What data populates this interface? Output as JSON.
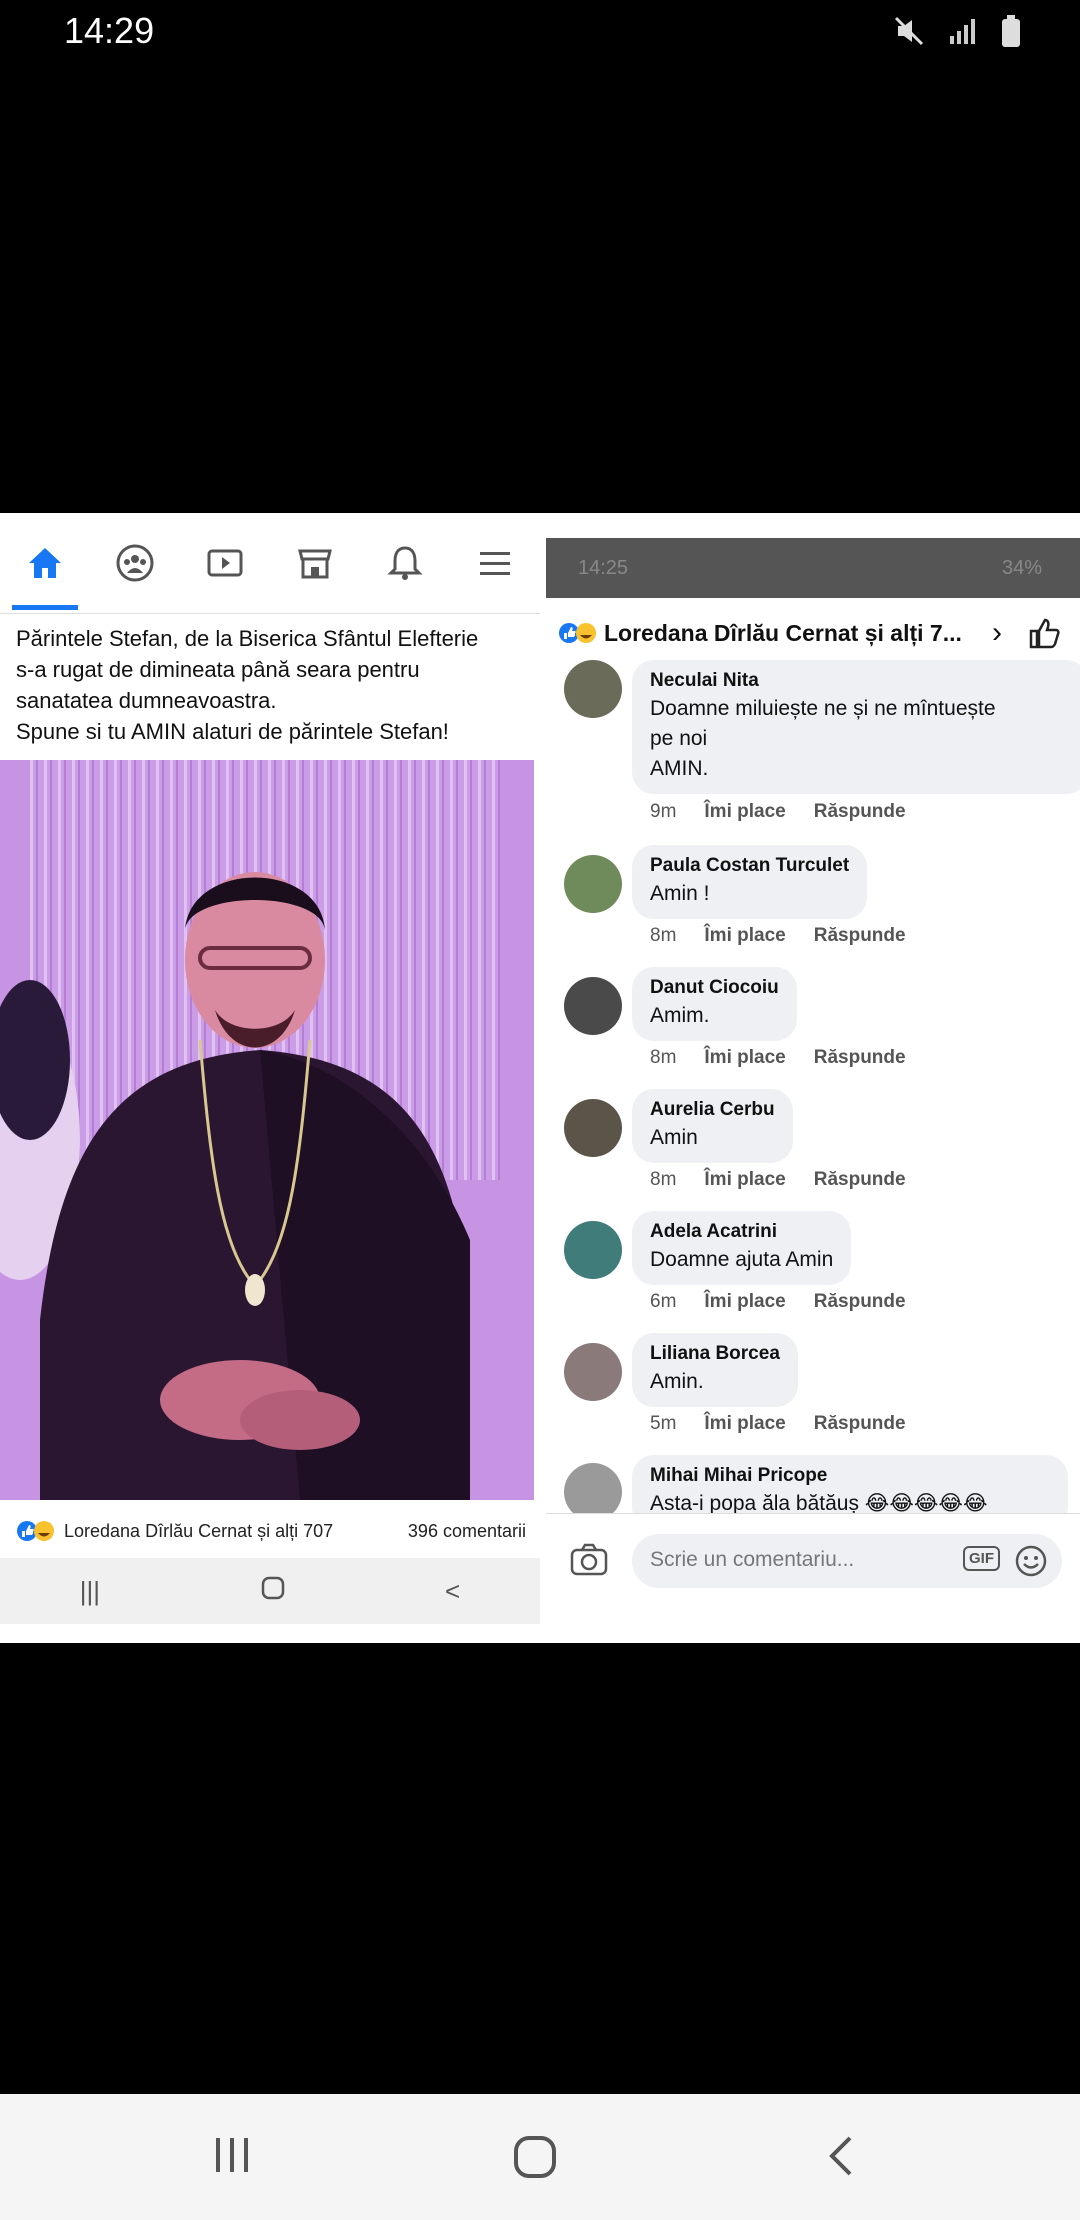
{
  "status_bar": {
    "time": "14:29"
  },
  "post": {
    "text_lines": [
      "Părintele Stefan, de la Biserica Sfântul Elefterie",
      "s-a rugat de dimineata până seara pentru",
      "sanatatea dumneavoastra.",
      "Spune si tu AMIN  alaturi de  părintele Stefan!"
    ],
    "reactions_names": "Loredana Dîrlău Cernat și alți 707",
    "comments_count": "396 comentarii"
  },
  "comments_panel": {
    "inner_status": {
      "time": "14:25",
      "battery": "34%"
    },
    "header_title": "Loredana Dîrlău Cernat și alți 7...",
    "comments": [
      {
        "name": "Neculai Nita",
        "text": [
          "Doamne miluiește ne și ne mîntuește",
          "pe noi",
          "AMIN."
        ],
        "time": "9m"
      },
      {
        "name": "Paula Costan Turculet",
        "text": [
          "Amin !"
        ],
        "time": "8m"
      },
      {
        "name": "Danut Ciocoiu",
        "text": [
          "Amim."
        ],
        "time": "8m"
      },
      {
        "name": "Aurelia Cerbu",
        "text": [
          "Amin"
        ],
        "time": "8m"
      },
      {
        "name": "Adela Acatrini",
        "text": [
          "Doamne ajuta Amin"
        ],
        "time": "6m"
      },
      {
        "name": "Liliana Borcea",
        "text": [
          "Amin."
        ],
        "time": "5m"
      },
      {
        "name": "Mihai Mihai Pricope",
        "text": [
          "Asta-i popa ăla bătăuș 😂😂😂😂😂"
        ],
        "time": ""
      }
    ],
    "like_label": "Îmi place",
    "reply_label": "Răspunde",
    "input_placeholder": "Scrie un comentariu...",
    "gif_label": "GIF"
  }
}
